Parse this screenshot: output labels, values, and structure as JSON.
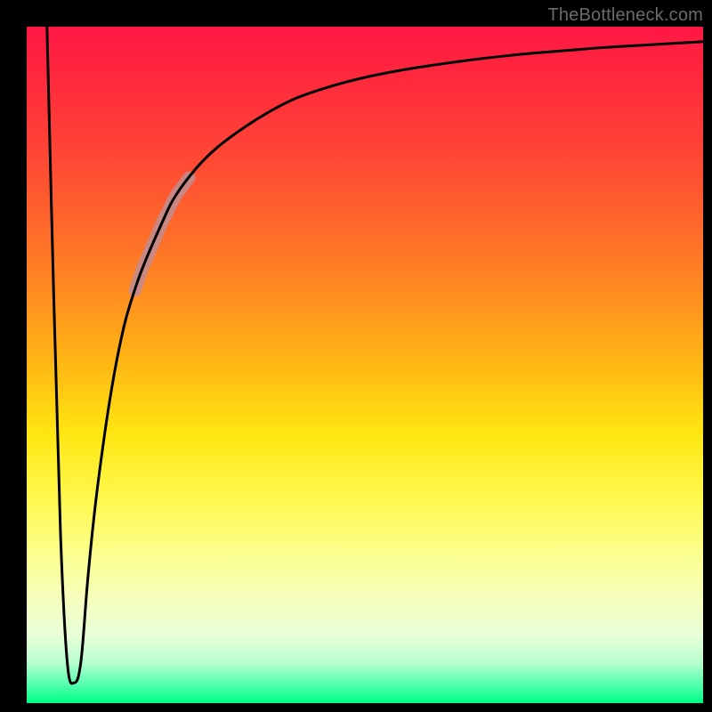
{
  "attribution": "TheBottleneck.com",
  "colors": {
    "page_bg": "#000000",
    "curve": "#000000",
    "highlight": "#c48a8a",
    "gradient_top": "#ff1744",
    "gradient_bottom": "#00ff88"
  },
  "chart_data": {
    "type": "line",
    "title": "",
    "xlabel": "",
    "ylabel": "",
    "xlim": [
      0,
      100
    ],
    "ylim": [
      0,
      100
    ],
    "grid": false,
    "legend": false,
    "series": [
      {
        "name": "curve",
        "x": [
          3,
          4,
          5,
          6,
          7,
          8,
          9,
          10,
          11,
          12,
          13,
          14,
          15,
          17,
          20,
          22,
          25,
          28,
          32,
          36,
          40,
          45,
          50,
          55,
          60,
          65,
          70,
          75,
          80,
          85,
          90,
          95,
          100
        ],
        "values": [
          100,
          60,
          25,
          6,
          3,
          6,
          18,
          28,
          36,
          43,
          49,
          54,
          58,
          64,
          71,
          75,
          79,
          82,
          85,
          87.5,
          89.5,
          91.2,
          92.5,
          93.5,
          94.3,
          95,
          95.6,
          96.1,
          96.5,
          96.9,
          97.2,
          97.5,
          97.8
        ]
      }
    ],
    "highlight_range_x": [
      16,
      24
    ],
    "notes": "Values read from curve position against a 0–100 vertical scale where 0 is bottom (green) and 100 is top (red). Curve starts at top-left, spikes down to near 0 around x≈6, then rises steeply and asymptotes near the top."
  }
}
